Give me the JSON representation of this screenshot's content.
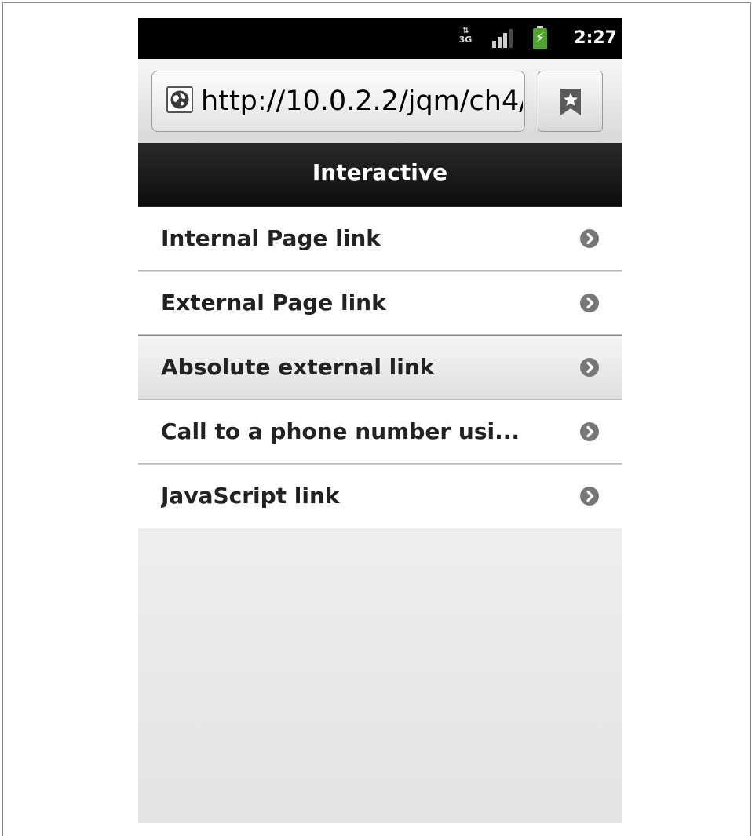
{
  "status_bar": {
    "network_type": "3G",
    "data_arrows": "⇅",
    "time": "2:27",
    "battery_glyph": "⚡",
    "icons": [
      "network-3g-icon",
      "signal-strength-icon",
      "battery-charging-icon"
    ]
  },
  "browser": {
    "url": "http://10.0.2.2/jqm/ch4/...",
    "site_icon": "globe-icon",
    "bookmark_icon": "bookmark-star-icon"
  },
  "page": {
    "title": "Interactive"
  },
  "list": {
    "items": [
      {
        "label": "Internal Page link",
        "icon": "chevron-right-icon"
      },
      {
        "label": "External Page link",
        "icon": "chevron-right-icon"
      },
      {
        "label": "Absolute external link",
        "icon": "chevron-right-icon"
      },
      {
        "label": "Call to a phone number usi...",
        "icon": "chevron-right-icon"
      },
      {
        "label": "JavaScript link",
        "icon": "chevron-right-icon"
      }
    ]
  },
  "colors": {
    "status_bar": "#000000",
    "header": "#111111",
    "battery": "#4fa32f",
    "arrow_circle": "#777777"
  }
}
